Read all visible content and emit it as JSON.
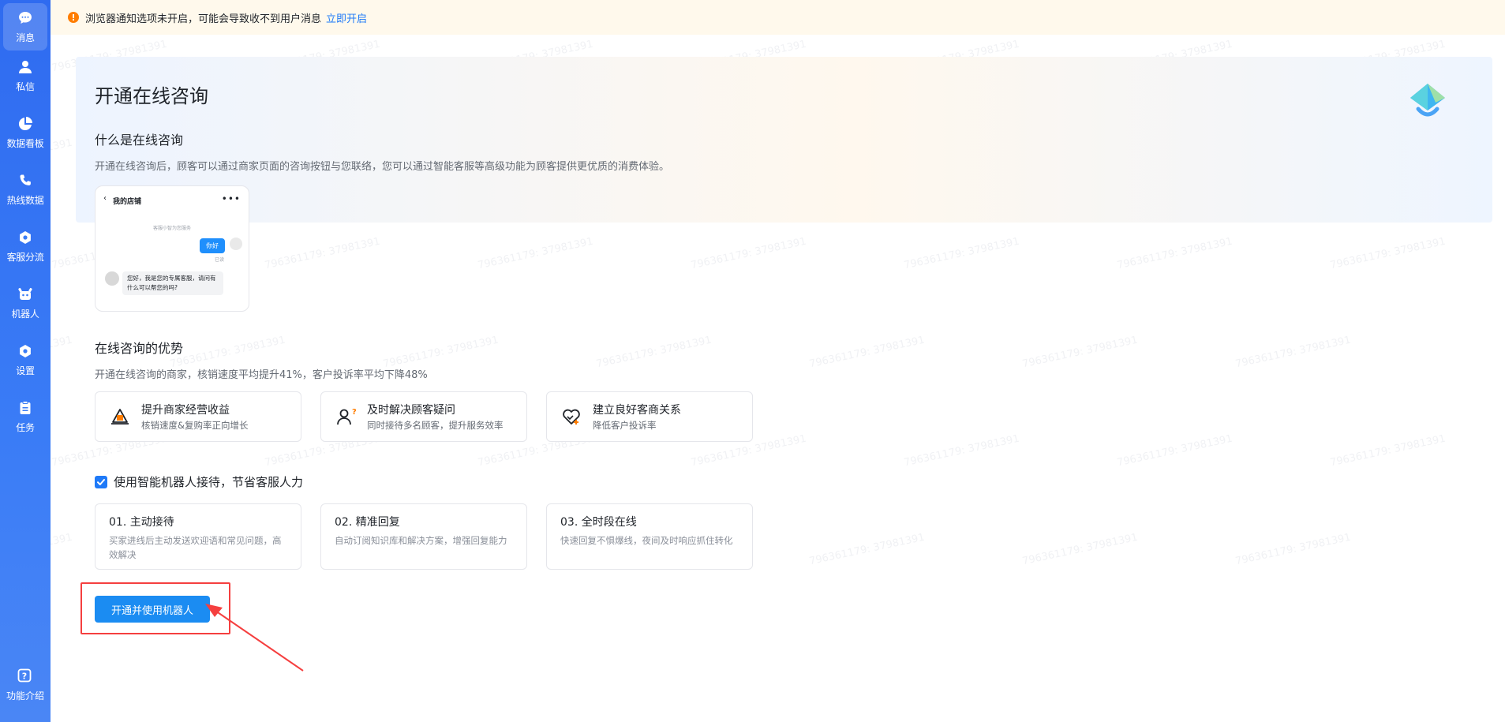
{
  "sidebar": {
    "items": [
      {
        "label": "消息",
        "icon": "chat-bubble-icon",
        "active": true
      },
      {
        "label": "私信",
        "icon": "user-icon"
      },
      {
        "label": "数据看板",
        "icon": "pie-chart-icon"
      },
      {
        "label": "热线数据",
        "icon": "phone-icon"
      },
      {
        "label": "客服分流",
        "icon": "routing-gear-icon"
      },
      {
        "label": "机器人",
        "icon": "robot-icon"
      },
      {
        "label": "设置",
        "icon": "settings-icon"
      },
      {
        "label": "任务",
        "icon": "clipboard-icon"
      }
    ],
    "help": {
      "label": "功能介绍",
      "icon": "question-icon"
    }
  },
  "notice": {
    "text": "浏览器通知选项未开启，可能会导致收不到用户消息",
    "link": "立即开启",
    "icon": "warning-icon"
  },
  "page": {
    "title": "开通在线咨询",
    "what_title": "什么是在线咨询",
    "what_desc": "开通在线咨询后，顾客可以通过商家页面的咨询按钮与您联络，您可以通过智能客服等高级功能为顾客提供更优质的消费体验。",
    "preview": {
      "shop_title": "我的店铺",
      "more": "•••",
      "hint": "客服小智为您服务",
      "user_msg": "你好",
      "read": "已读",
      "agent_msg": "您好，我是您的专属客服，请问有什么可以帮您的吗?"
    },
    "advantage_title": "在线咨询的优势",
    "advantage_desc": "开通在线咨询的商家，核销速度平均提升41%，客户投诉率平均下降48%",
    "benefits": [
      {
        "title": "提升商家经营收益",
        "sub": "核销速度&复购率正向增长",
        "icon": "revenue-icon"
      },
      {
        "title": "及时解决顾客疑问",
        "sub": "同时接待多名顾客，提升服务效率",
        "icon": "question-user-icon"
      },
      {
        "title": "建立良好客商关系",
        "sub": "降低客户投诉率",
        "icon": "heart-handshake-icon"
      }
    ],
    "robot_checkbox": "使用智能机器人接待，节省客服人力",
    "robot_checked": true,
    "features": [
      {
        "title": "01. 主动接待",
        "sub": "买家进线后主动发送欢迎语和常见问题，高效解决"
      },
      {
        "title": "02. 精准回复",
        "sub": "自动订阅知识库和解决方案，增强回复能力"
      },
      {
        "title": "03. 全时段在线",
        "sub": "快速回复不惧爆线，夜间及时响应抓住转化"
      }
    ],
    "cta_label": "开通并使用机器人"
  },
  "watermark": "796361179: 37981391",
  "colors": {
    "sidebar": "#2f6bf0",
    "accent": "#1b8cf2",
    "highlight": "#f53f3f",
    "notice_bg": "#fff9ec",
    "warning": "#ff7d00"
  }
}
